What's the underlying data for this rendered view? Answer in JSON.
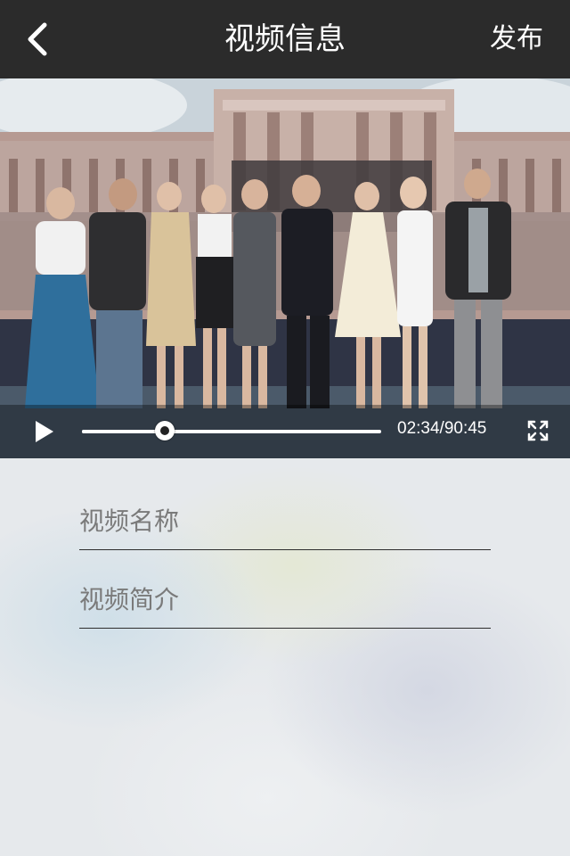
{
  "nav": {
    "title": "视频信息",
    "publish_label": "发布",
    "back_icon": "chevron-left-icon"
  },
  "player": {
    "time_text": "02:34/90:45",
    "progress": 0.278,
    "play_icon": "play-icon",
    "fullscreen_icon": "fullscreen-icon"
  },
  "form": {
    "name_placeholder": "视频名称",
    "name_value": "",
    "intro_placeholder": "视频简介",
    "intro_value": ""
  },
  "colors": {
    "navbar_bg": "#2b2b2b",
    "text_light": "#ffffff",
    "placeholder": "#7a7a7a"
  }
}
